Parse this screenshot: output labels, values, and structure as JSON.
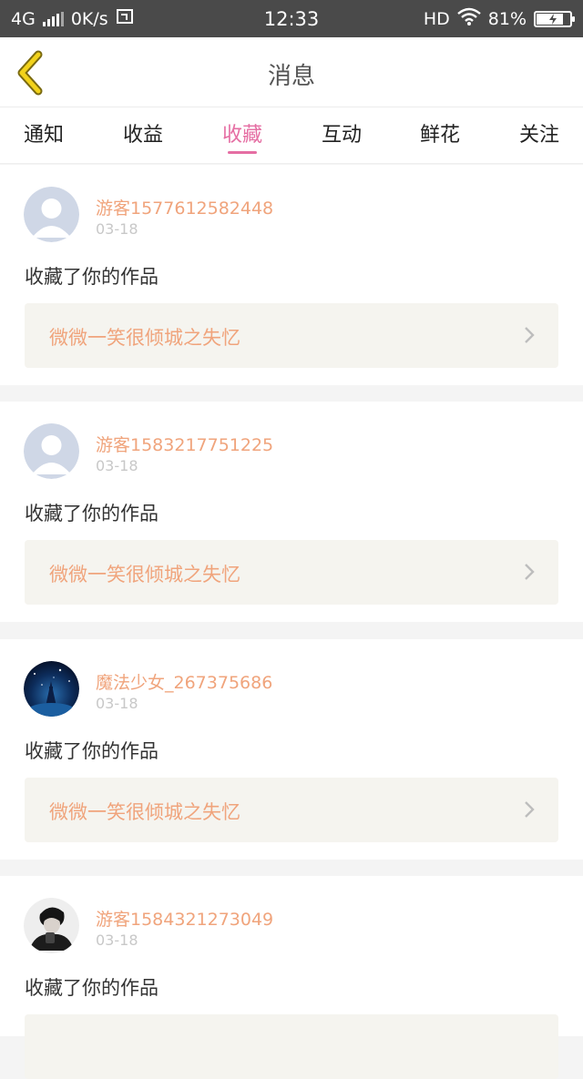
{
  "status_bar": {
    "network": "4G",
    "speed": "0K/s",
    "time": "12:33",
    "hd": "HD",
    "battery": "81%",
    "battery_level": 0.81
  },
  "nav": {
    "title": "消息"
  },
  "tabs": [
    {
      "label": "通知"
    },
    {
      "label": "收益"
    },
    {
      "label": "收藏",
      "active": true
    },
    {
      "label": "互动"
    },
    {
      "label": "鲜花"
    },
    {
      "label": "关注"
    }
  ],
  "messages": [
    {
      "username": "游客1577612582448",
      "date": "03-18",
      "action": "收藏了你的作品",
      "work": "微微一笑很倾城之失忆",
      "avatar": "default-avatar"
    },
    {
      "username": "游客1583217751225",
      "date": "03-18",
      "action": "收藏了你的作品",
      "work": "微微一笑很倾城之失忆",
      "avatar": "default-avatar"
    },
    {
      "username": "魔法少女_267375686",
      "date": "03-18",
      "action": "收藏了你的作品",
      "work": "微微一笑很倾城之失忆",
      "avatar": "night-sky-avatar"
    },
    {
      "username": "游客1584321273049",
      "date": "03-18",
      "action": "收藏了你的作品",
      "work": "",
      "avatar": "person-avatar"
    }
  ],
  "colors": {
    "accent": "#e56ea3",
    "name": "#f0a47c",
    "back_icon": "#f2d21a"
  }
}
